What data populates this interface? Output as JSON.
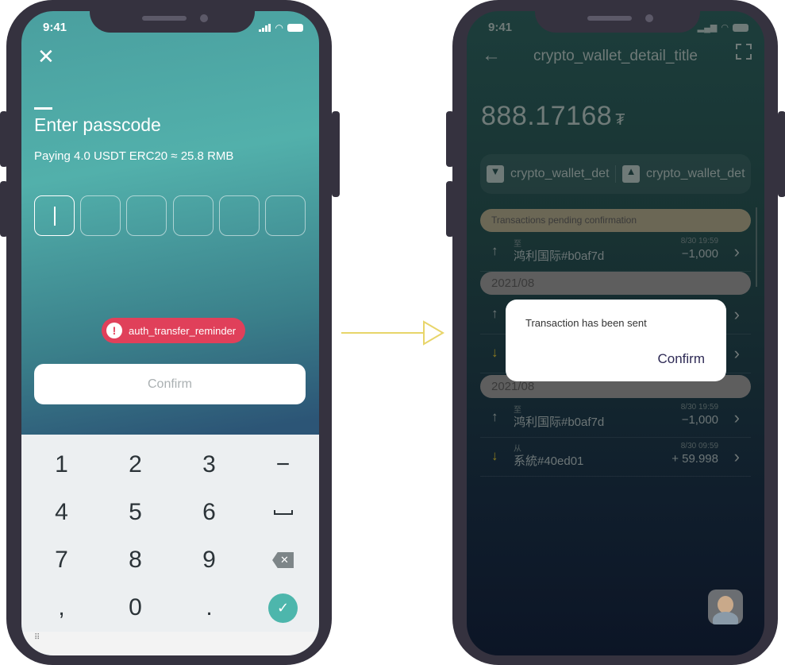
{
  "left_screen": {
    "status": {
      "time": "9:41"
    },
    "close_icon": "close-icon",
    "title": "Enter passcode",
    "subtitle": "Paying 4.0 USDT ERC20 ≈ 25.8 RMB",
    "passcode_length": 6,
    "reminder": "auth_transfer_reminder",
    "confirm_label": "Confirm",
    "keys": [
      "1",
      "2",
      "3",
      "−",
      "4",
      "5",
      "6",
      "␣",
      "7",
      "8",
      "9",
      "⌫",
      ",",
      "0",
      ".",
      "✓"
    ],
    "colors": {
      "accent": "#4db6ac",
      "error": "#e0405a"
    }
  },
  "right_screen": {
    "status": {
      "time": "9:41"
    },
    "title": "crypto_wallet_detail_title",
    "balance": "888.17168",
    "currency_symbol": "₮",
    "actions": [
      "crypto_wallet_det",
      "crypto_wallet_det"
    ],
    "pending_header": "Transactions pending confirmation",
    "pending": [
      {
        "direction": "out",
        "label": "至",
        "name": "鸿利国际#b0af7d",
        "date": "8/30 19:59",
        "amount": "−1,000"
      }
    ],
    "groups": [
      {
        "month": "2021/08",
        "rows": [
          {
            "direction": "out"
          },
          {
            "direction": "in"
          }
        ]
      },
      {
        "month": "2021/08",
        "rows": [
          {
            "direction": "out",
            "label": "至",
            "name": "鸿利国际#b0af7d",
            "date": "8/30 19:59",
            "amount": "−1,000"
          },
          {
            "direction": "in",
            "label": "从",
            "name": "系統#40ed01",
            "date": "8/30 09:59",
            "amount": "+ 59.998"
          }
        ]
      }
    ],
    "dialog": {
      "message": "Transaction has been sent",
      "confirm": "Confirm"
    }
  }
}
